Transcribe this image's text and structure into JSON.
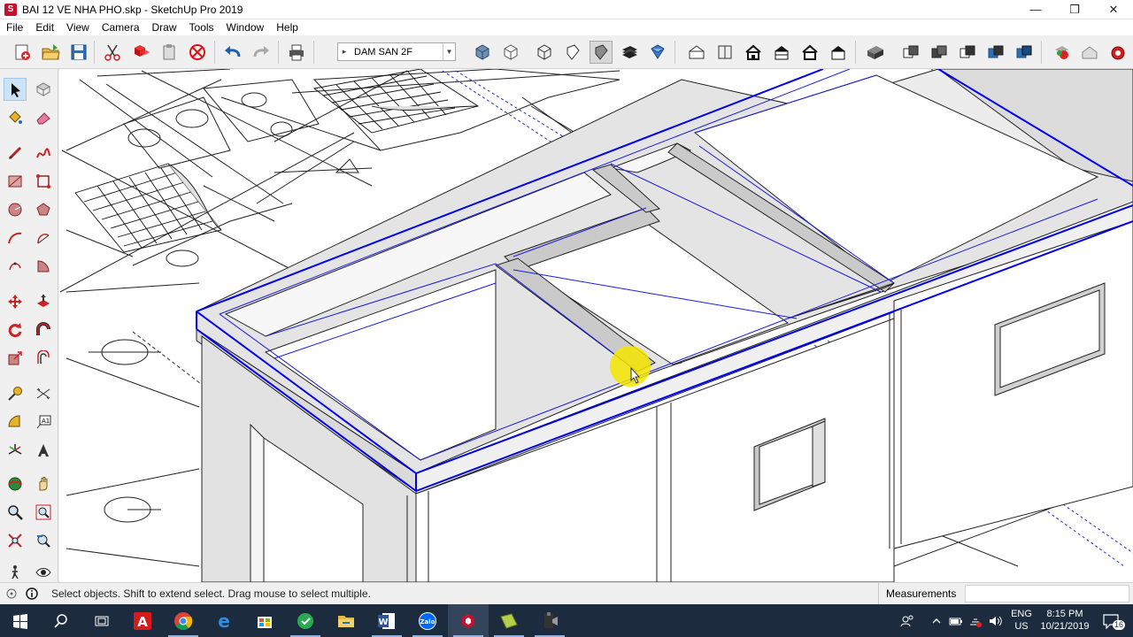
{
  "window": {
    "title": "BAI 12 VE NHA PHO.skp - SketchUp Pro 2019",
    "minimize_glyph": "—",
    "maximize_glyph": "❐",
    "close_glyph": "✕"
  },
  "menubar": {
    "items": [
      "File",
      "Edit",
      "View",
      "Camera",
      "Draw",
      "Tools",
      "Window",
      "Help"
    ]
  },
  "toolbar": {
    "scene_value": "DAM SAN 2F",
    "scene_bullet": "▸",
    "scene_arrow": "▼"
  },
  "status": {
    "hint": "Select objects. Shift to extend select. Drag mouse to select multiple.",
    "measurements_label": "Measurements",
    "measurements_value": ""
  },
  "taskbar": {
    "lang_line1": "ENG",
    "lang_line2": "US",
    "time": "8:15 PM",
    "date": "10/21/2019",
    "notification_count": "16"
  },
  "colors": {
    "accent_blue": "#0000ee",
    "taskbar_bg": "#1c2b3d",
    "cursor_highlight": "#f5e600"
  }
}
